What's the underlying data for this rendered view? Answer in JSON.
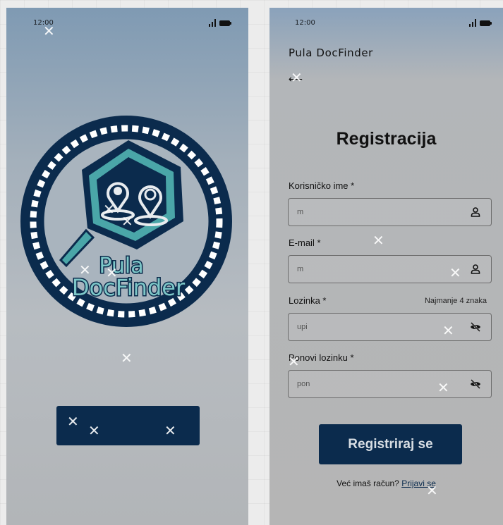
{
  "colors": {
    "brand_navy": "#0b2b4d",
    "brand_teal": "#4aa6a8",
    "logo_fill": "#7dc7c8"
  },
  "splash": {
    "status": {
      "time": "12:00"
    },
    "logo": {
      "line1": "Pula",
      "line2": "DocFinder"
    },
    "button": {
      "label": ""
    }
  },
  "register": {
    "status": {
      "time": "12:00"
    },
    "app_title": "Pula DocFinder",
    "back_icon": "arrow-left-icon",
    "title": "Registracija",
    "fields": [
      {
        "label": "Korisničko ime *",
        "hint": "",
        "placeholder": "m",
        "icon": "user-icon"
      },
      {
        "label": "E-mail *",
        "hint": "",
        "placeholder": "m",
        "icon": "user-icon"
      },
      {
        "label": "Lozinka *",
        "hint": "Najmanje 4 znaka",
        "placeholder": "upi",
        "icon": "eye-off-icon"
      },
      {
        "label": "Ponovi lozinku *",
        "hint": "",
        "placeholder": "pon",
        "icon": "eye-off-icon"
      }
    ],
    "submit_label": "Registriraj se",
    "login_prompt": "Već imaš račun?",
    "login_link": "Prijavi se"
  }
}
